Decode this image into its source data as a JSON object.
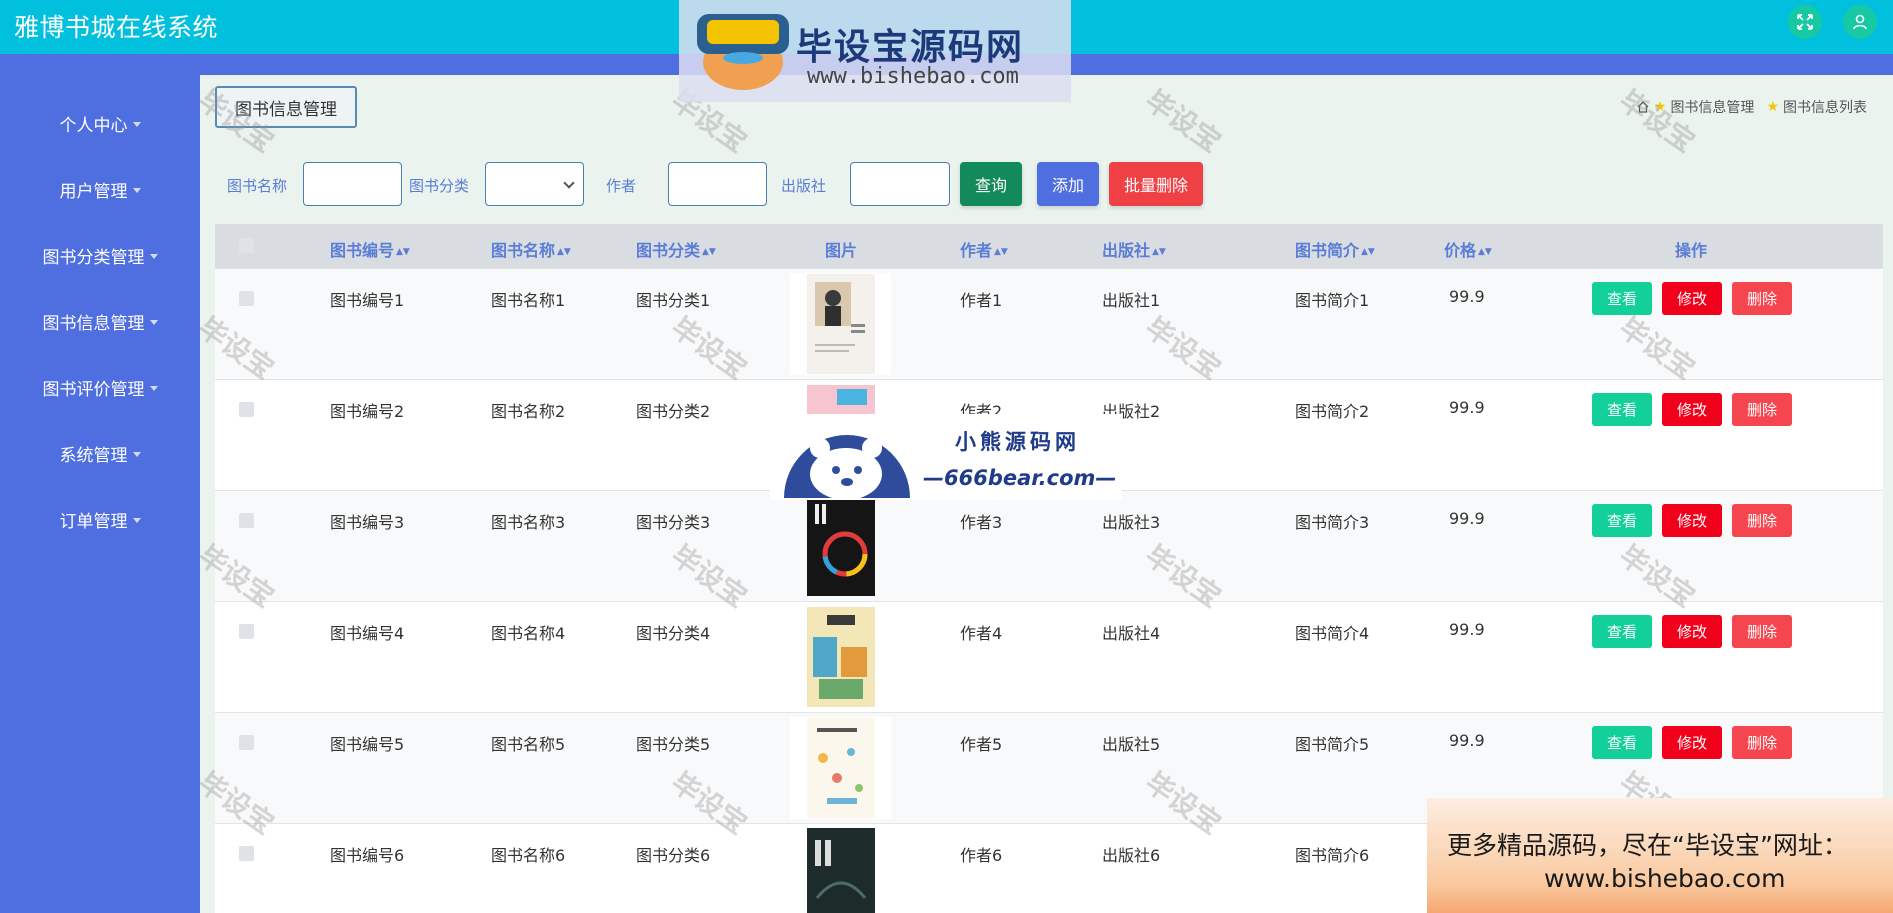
{
  "header": {
    "title": "雅博书城在线系统",
    "fullscreen_icon": "fullscreen-icon",
    "user_icon": "user-icon",
    "accent_color": "#00c0de",
    "sidebar_color": "#4f6fe0"
  },
  "sidebar": {
    "items": [
      {
        "label": "个人中心"
      },
      {
        "label": "用户管理"
      },
      {
        "label": "图书分类管理"
      },
      {
        "label": "图书信息管理"
      },
      {
        "label": "图书评价管理"
      },
      {
        "label": "系统管理"
      },
      {
        "label": "订单管理"
      }
    ]
  },
  "page": {
    "tag": "图书信息管理",
    "breadcrumb": [
      "图书信息管理",
      "图书信息列表"
    ]
  },
  "search": {
    "name_label": "图书名称",
    "name_value": "",
    "category_label": "图书分类",
    "category_value": "",
    "author_label": "作者",
    "author_value": "",
    "publisher_label": "出版社",
    "publisher_value": "",
    "query_button": "查询",
    "add_button": "添加",
    "batch_delete_button": "批量删除"
  },
  "table": {
    "headers": {
      "code": "图书编号",
      "name": "图书名称",
      "category": "图书分类",
      "image": "图片",
      "author": "作者",
      "publisher": "出版社",
      "intro": "图书简介",
      "price": "价格",
      "actions": "操作"
    },
    "actions": {
      "view": "查看",
      "edit": "修改",
      "delete": "删除"
    },
    "rows": [
      {
        "code": "图书编号1",
        "name": "图书名称1",
        "category": "图书分类1",
        "author": "作者1",
        "publisher": "出版社1",
        "intro": "图书简介1",
        "price": "99.9"
      },
      {
        "code": "图书编号2",
        "name": "图书名称2",
        "category": "图书分类2",
        "author": "作者2",
        "publisher": "出版社2",
        "intro": "图书简介2",
        "price": "99.9"
      },
      {
        "code": "图书编号3",
        "name": "图书名称3",
        "category": "图书分类3",
        "author": "作者3",
        "publisher": "出版社3",
        "intro": "图书简介3",
        "price": "99.9"
      },
      {
        "code": "图书编号4",
        "name": "图书名称4",
        "category": "图书分类4",
        "author": "作者4",
        "publisher": "出版社4",
        "intro": "图书简介4",
        "price": "99.9"
      },
      {
        "code": "图书编号5",
        "name": "图书名称5",
        "category": "图书分类5",
        "author": "作者5",
        "publisher": "出版社5",
        "intro": "图书简介5",
        "price": "99.9"
      },
      {
        "code": "图书编号6",
        "name": "图书名称6",
        "category": "图书分类6",
        "author": "作者6",
        "publisher": "出版社6",
        "intro": "图书简介6",
        "price": ""
      }
    ]
  },
  "watermarks": {
    "tile_text": "毕设宝",
    "logo_title": "毕设宝源码网",
    "logo_url": "www.bishebao.com",
    "bear_title": "小熊源码网",
    "bear_url": "—666bear.com—",
    "promo_line1": "更多精品源码，尽在“毕设宝”网址：",
    "promo_line2": "www.bishebao.com"
  }
}
